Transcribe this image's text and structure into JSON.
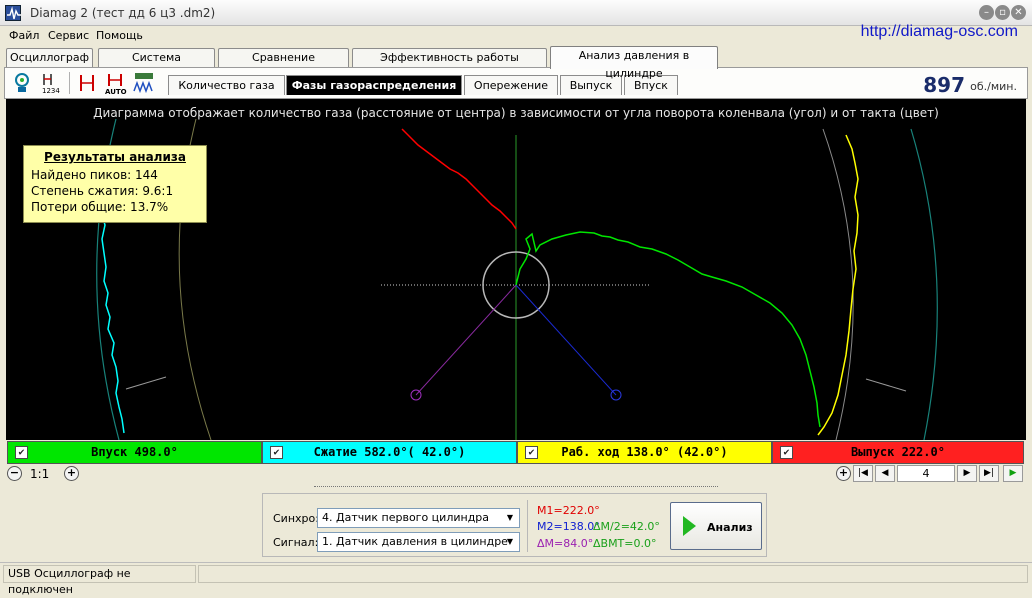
{
  "window": {
    "title": "Diamag 2 (тест дд 6 ц3 .dm2)",
    "url": "http://diamag-osc.com"
  },
  "menu": {
    "items": [
      "Файл",
      "Сервис",
      "Помощь"
    ]
  },
  "tabs": [
    {
      "label": "Осциллограф"
    },
    {
      "label": "Система зажигания"
    },
    {
      "label": "Сравнение цилиндров"
    },
    {
      "label": "Эффективность работы цилиндров"
    },
    {
      "label": "Анализ давления в цилиндре",
      "active": true
    }
  ],
  "toolbar": {
    "icons": [
      "sensor-icon",
      "numbering-icon",
      "markers-icon",
      "auto-markers-icon",
      "waveform-icon"
    ]
  },
  "subtabs": [
    {
      "label": "Количество газа"
    },
    {
      "label": "Фазы газораспределения",
      "active": true
    },
    {
      "label": "Опережение"
    },
    {
      "label": "Выпуск"
    },
    {
      "label": "Впуск"
    }
  ],
  "rpm": {
    "value": "897",
    "unit": "об./мин."
  },
  "diagram": {
    "caption": "Диаграмма отображает количество газа (расстояние от центра) в зависимости от угла поворота коленвала (угол) и от такта (цвет)",
    "colors": {
      "intake": "#00ff00",
      "compression": "#00ffff",
      "power": "#ffff00",
      "exhaust": "#ff0000"
    }
  },
  "results": {
    "title": "Результаты анализа",
    "lines": [
      "Найдено пиков: 144",
      "Степень сжатия: 9.6:1",
      "Потери общие: 13.7%"
    ]
  },
  "phases": [
    {
      "label": "Впуск 498.0°",
      "color": "#00e600"
    },
    {
      "label": "Сжатие 582.0°( 42.0°)",
      "color": "#00ffff"
    },
    {
      "label": "Раб. ход 138.0° (42.0°)",
      "color": "#ffff00"
    },
    {
      "label": "Выпуск 222.0°",
      "color": "#ff2020"
    }
  ],
  "zoom": {
    "scale": "1:1"
  },
  "nav": {
    "frame": "4"
  },
  "controls": {
    "sync_label": "Синхро:",
    "sync_value": "4.  Датчик первого цилиндра",
    "signal_label": "Сигнал:",
    "signal_value": "1.  Датчик давления в цилиндре"
  },
  "measurements": {
    "m1": "M1=222.0°",
    "m2": "M2=138.0°",
    "dm2": "ΔM/2=42.0°",
    "dm": "ΔM=84.0°",
    "dbmt": "ΔBMT=0.0°"
  },
  "analyze_button": {
    "label": "Анализ"
  },
  "status": {
    "text": "USB Осциллограф не подключен"
  }
}
